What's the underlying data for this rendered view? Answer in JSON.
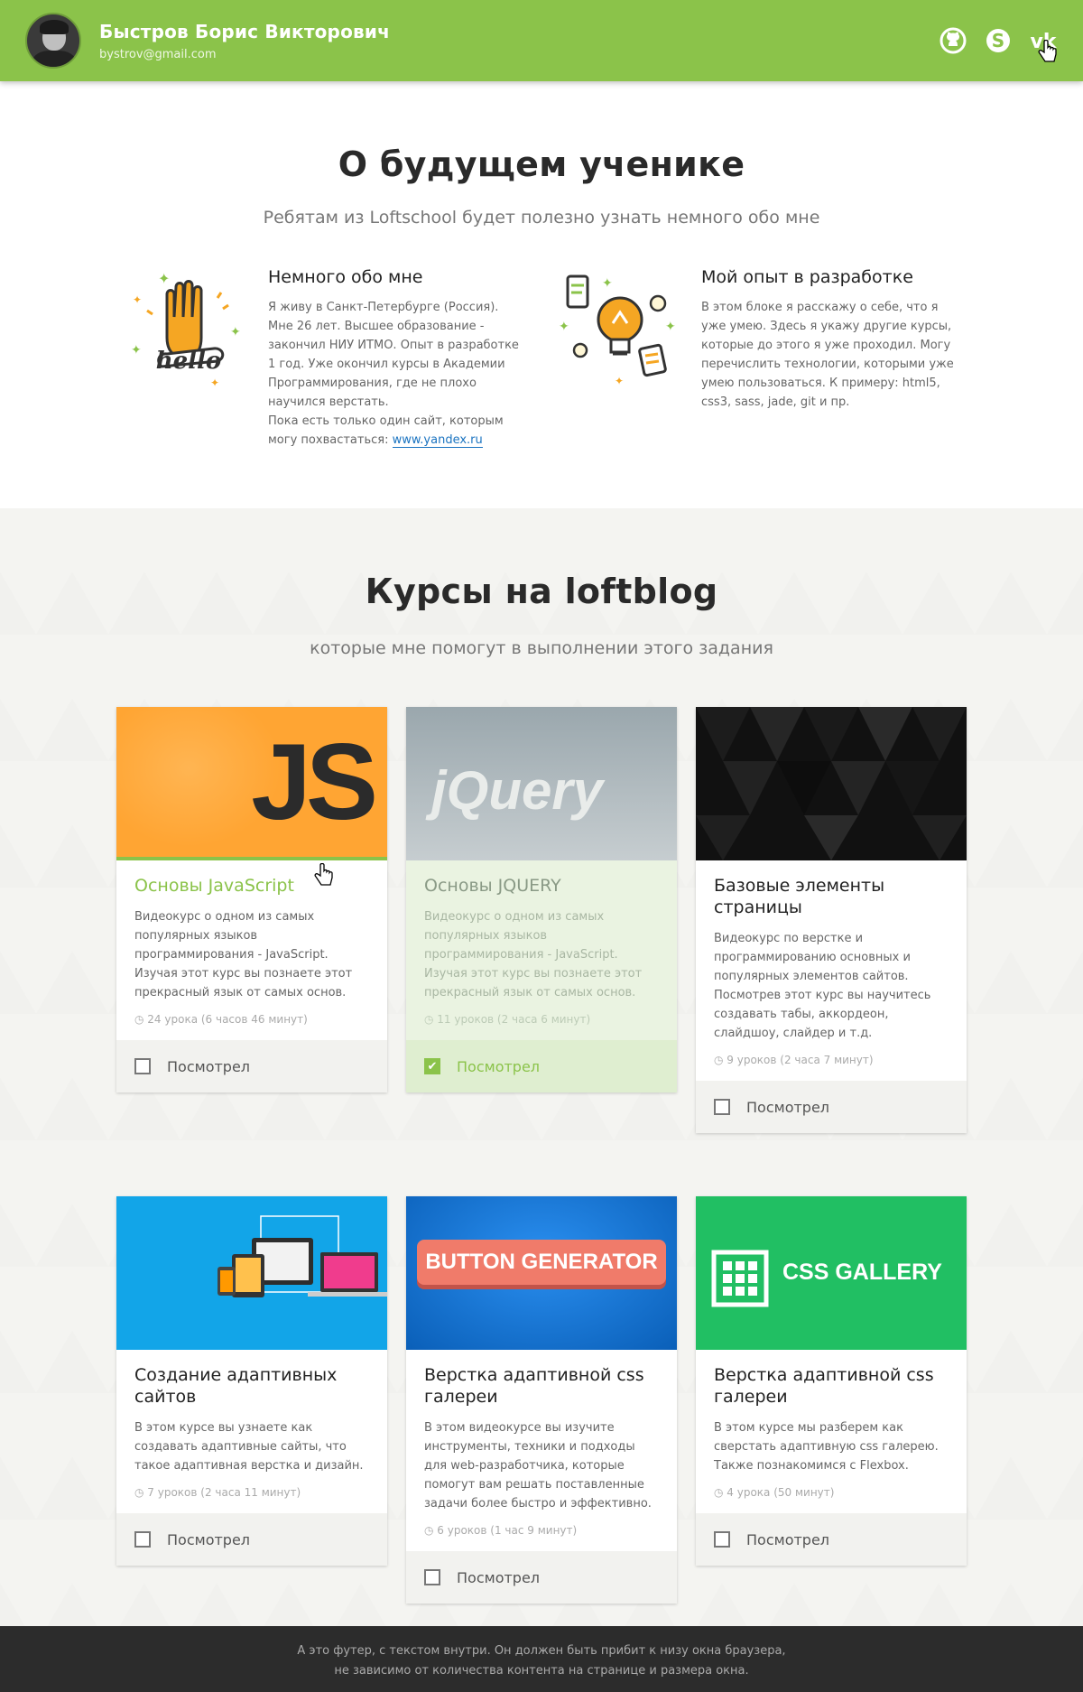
{
  "header": {
    "name": "Быстров Борис Викторович",
    "email": "bystrov@gmail.com",
    "socials": [
      "github-icon",
      "skype-icon",
      "vk-icon"
    ],
    "accent": "#8bc34a"
  },
  "about": {
    "title": "О будущем ученике",
    "subtitle": "Ребятам из Loftschool будет полезно узнать немного обо мне",
    "items": [
      {
        "heading": "Немного обо мне",
        "text": "Я живу в Санкт-Петербурге (Россия). Мне 26 лет. Высшее образование - закончил НИУ ИТМО. Опыт в разработке 1 год. Уже окончил курсы в Академии Программирования, где не плохо научился верстать.",
        "text2": "Пока есть только один сайт, которым могу похвастаться: ",
        "link": "www.yandex.ru",
        "icon": "hello-hand-icon"
      },
      {
        "heading": "Мой опыт в разработке",
        "text": "В этом блоке я расскажу о себе, что я уже умею. Здесь я укажу другие курсы, которые до этого я уже проходил. Могу перечислить технологии, которыми уже умею пользоваться. К примеру: html5, css3, sass, jade, git и пр.",
        "icon": "lightbulb-icon"
      }
    ]
  },
  "courses": {
    "title": "Курсы на loftblog",
    "subtitle": "которые мне помогут в выполнении этого задания",
    "items": [
      {
        "title": "Основы JavaScript",
        "desc": "Видеокурс о одном из самых популярных языков программирования - JavaScript. Изучая этот курс вы познаете этот прекрасный язык от самых основ.",
        "meta": "24 урока (6 часов 46 минут)",
        "watched_label": "Посмотрел",
        "thumb_text": "JS"
      },
      {
        "title": "Основы JQUERY",
        "desc": "Видеокурс о одном из самых популярных языков программирования - JavaScript. Изучая этот курс вы познаете этот прекрасный язык от самых основ.",
        "meta": "11 уроков (2 часа 6 минут)",
        "watched_label": "Посмотрел",
        "thumb_text": "jQuery"
      },
      {
        "title": "Базовые элементы страницы",
        "desc": "Видеокурс по верстке и программированию основных и популярных элементов сайтов. Посмотрев этот курс вы научитесь создавать табы, аккордеон, слайдшоу, слайдер и т.д.",
        "meta": "9 уроков (2 часа 7 минут)",
        "watched_label": "Посмотрел",
        "thumb_text": ""
      },
      {
        "title": "Создание адаптивных сайтов",
        "desc": "В этом курсе вы узнаете как создавать адаптивные сайты, что такое адаптивная верстка и дизайн.",
        "meta": "7 уроков (2 часа 11 минут)",
        "watched_label": "Посмотрел",
        "thumb_text": ""
      },
      {
        "title": "Верстка адаптивной css галереи",
        "desc": "В этом видеокурсе вы изучите инструменты, техники и подходы для web-разработчика, которые помогут вам решать поставленные задачи более быстро и эффективно.",
        "meta": "6 уроков (1 час 9 минут)",
        "watched_label": "Посмотрел",
        "thumb_text": "BUTTON GENERATOR"
      },
      {
        "title": "Верстка адаптивной css галереи",
        "desc": "В этом курсе мы разберем как сверстать адаптивную css галерею. Также познакомимся с Flexbox.",
        "meta": "4 урока (50 минут)",
        "watched_label": "Посмотрел",
        "thumb_text": "CSS GALLERY"
      }
    ]
  },
  "footer": {
    "line1": "А это футер, с текстом внутри. Он должен быть прибит к низу окна браузера,",
    "line2": "не зависимо от количества контента на странице и размера окна."
  }
}
